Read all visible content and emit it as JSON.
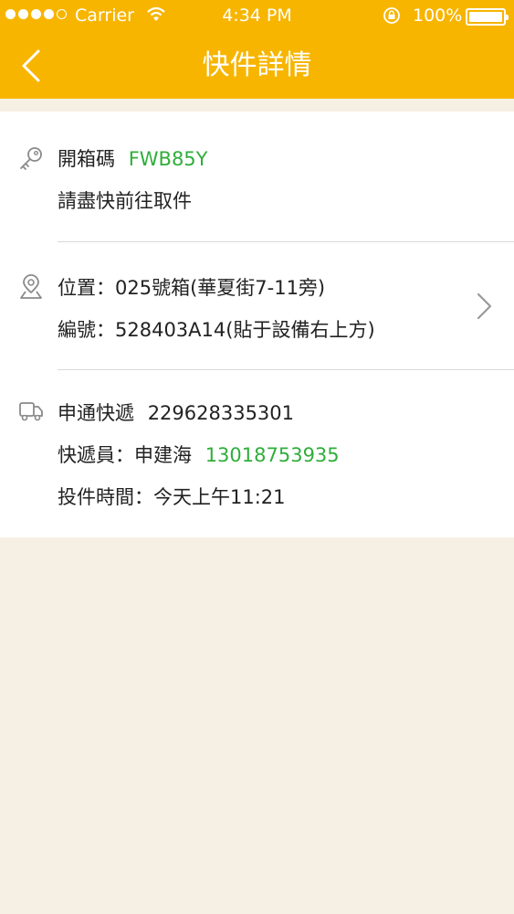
{
  "status_bar": {
    "carrier": "Carrier",
    "time": "4:34 PM",
    "battery": "100%"
  },
  "nav": {
    "title": "快件詳情"
  },
  "pickup": {
    "code_label": "開箱碼",
    "code": "FWB85Y",
    "note": "請盡快前往取件"
  },
  "location": {
    "position_label": "位置：",
    "position_value": "025號箱(華夏街7-11旁)",
    "number_label": "編號：",
    "number_value": "528403A14(貼于設備右上方)"
  },
  "courier": {
    "company": "申通快遞",
    "tracking_number": "229628335301",
    "courier_label": "快遞員：",
    "courier_name": "申建海",
    "phone": "13018753935",
    "delivery_time_label": "投件時間：",
    "delivery_time": "今天上午11:21"
  },
  "colors": {
    "header": "#f7b500",
    "accent_green": "#2fae3a",
    "background": "#f6efe4"
  }
}
